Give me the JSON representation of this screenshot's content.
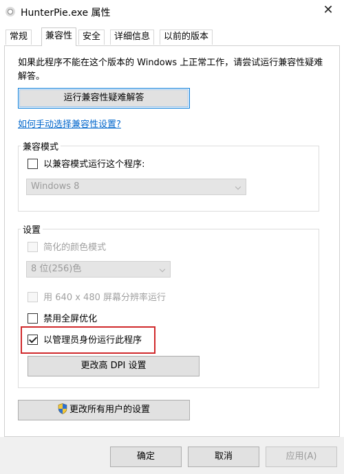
{
  "window": {
    "title": "HunterPie.exe 属性",
    "close_glyph": "✕"
  },
  "tabs": [
    {
      "label": "常规"
    },
    {
      "label": "兼容性"
    },
    {
      "label": "安全"
    },
    {
      "label": "详细信息"
    },
    {
      "label": "以前的版本"
    }
  ],
  "active_tab": "兼容性",
  "intro_text": "如果此程序不能在这个版本的 Windows 上正常工作，请尝试运行兼容性疑难解答。",
  "troubleshooter_button": "运行兼容性疑难解答",
  "manual_link": "如何手动选择兼容性设置?",
  "compat_mode": {
    "group_label": "兼容模式",
    "checkbox_label": "以兼容模式运行这个程序:",
    "checked": false,
    "os_selected": "Windows 8"
  },
  "settings": {
    "group_label": "设置",
    "reduced_color": {
      "label": "简化的颜色模式",
      "checked": false,
      "enabled": false
    },
    "color_selected": "8 位(256)色",
    "low_res": {
      "label": "用 640 x 480 屏幕分辨率运行",
      "checked": false,
      "enabled": false
    },
    "disable_fullscreen": {
      "label": "禁用全屏优化",
      "checked": false,
      "enabled": true
    },
    "run_as_admin": {
      "label": "以管理员身份运行此程序",
      "checked": true,
      "enabled": true
    },
    "dpi_button": "更改高 DPI 设置"
  },
  "all_users_button": "更改所有用户的设置",
  "footer": {
    "ok": "确定",
    "cancel": "取消",
    "apply": "应用(A)"
  },
  "colors": {
    "accent": "#0078d7",
    "link": "#0066cc",
    "highlight": "#d0282a"
  }
}
